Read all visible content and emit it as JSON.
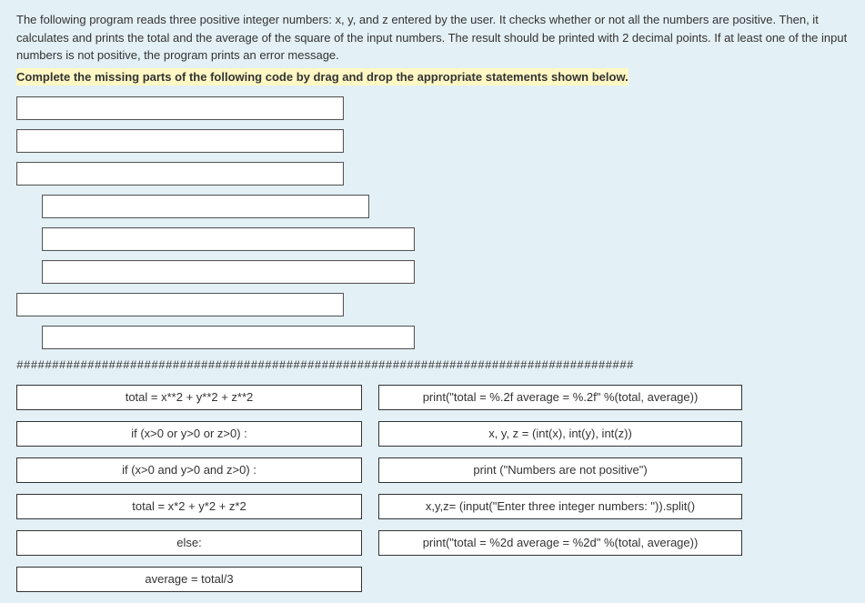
{
  "description": "The following program reads three positive integer numbers: x, y, and z entered by the user.  It checks whether or not all the numbers are positive. Then, it calculates and prints the total and the average of the square of the input numbers. The result should be printed with 2 decimal points. If at least one of the input numbers is not positive, the program prints an error message.",
  "instruction": "Complete the missing parts of the following code by drag and drop the appropriate statements shown below.",
  "divider": "#######################################################################################",
  "choices": {
    "left": [
      "total = x**2 +  y**2 + z**2",
      "if (x>0 or y>0 or z>0) :",
      "if (x>0 and y>0 and z>0) :",
      "total = x*2 +  y*2 + z*2",
      "else:",
      "average = total/3"
    ],
    "right": [
      "print(\"total = %.2f     average = %.2f\" %(total, average))",
      "x, y, z = (int(x), int(y), int(z))",
      "print (\"Numbers are not positive\")",
      "x,y,z= (input(\"Enter three integer numbers: \")).split()",
      "print(\"total = %2d     average = %2d\" %(total, average))"
    ]
  }
}
